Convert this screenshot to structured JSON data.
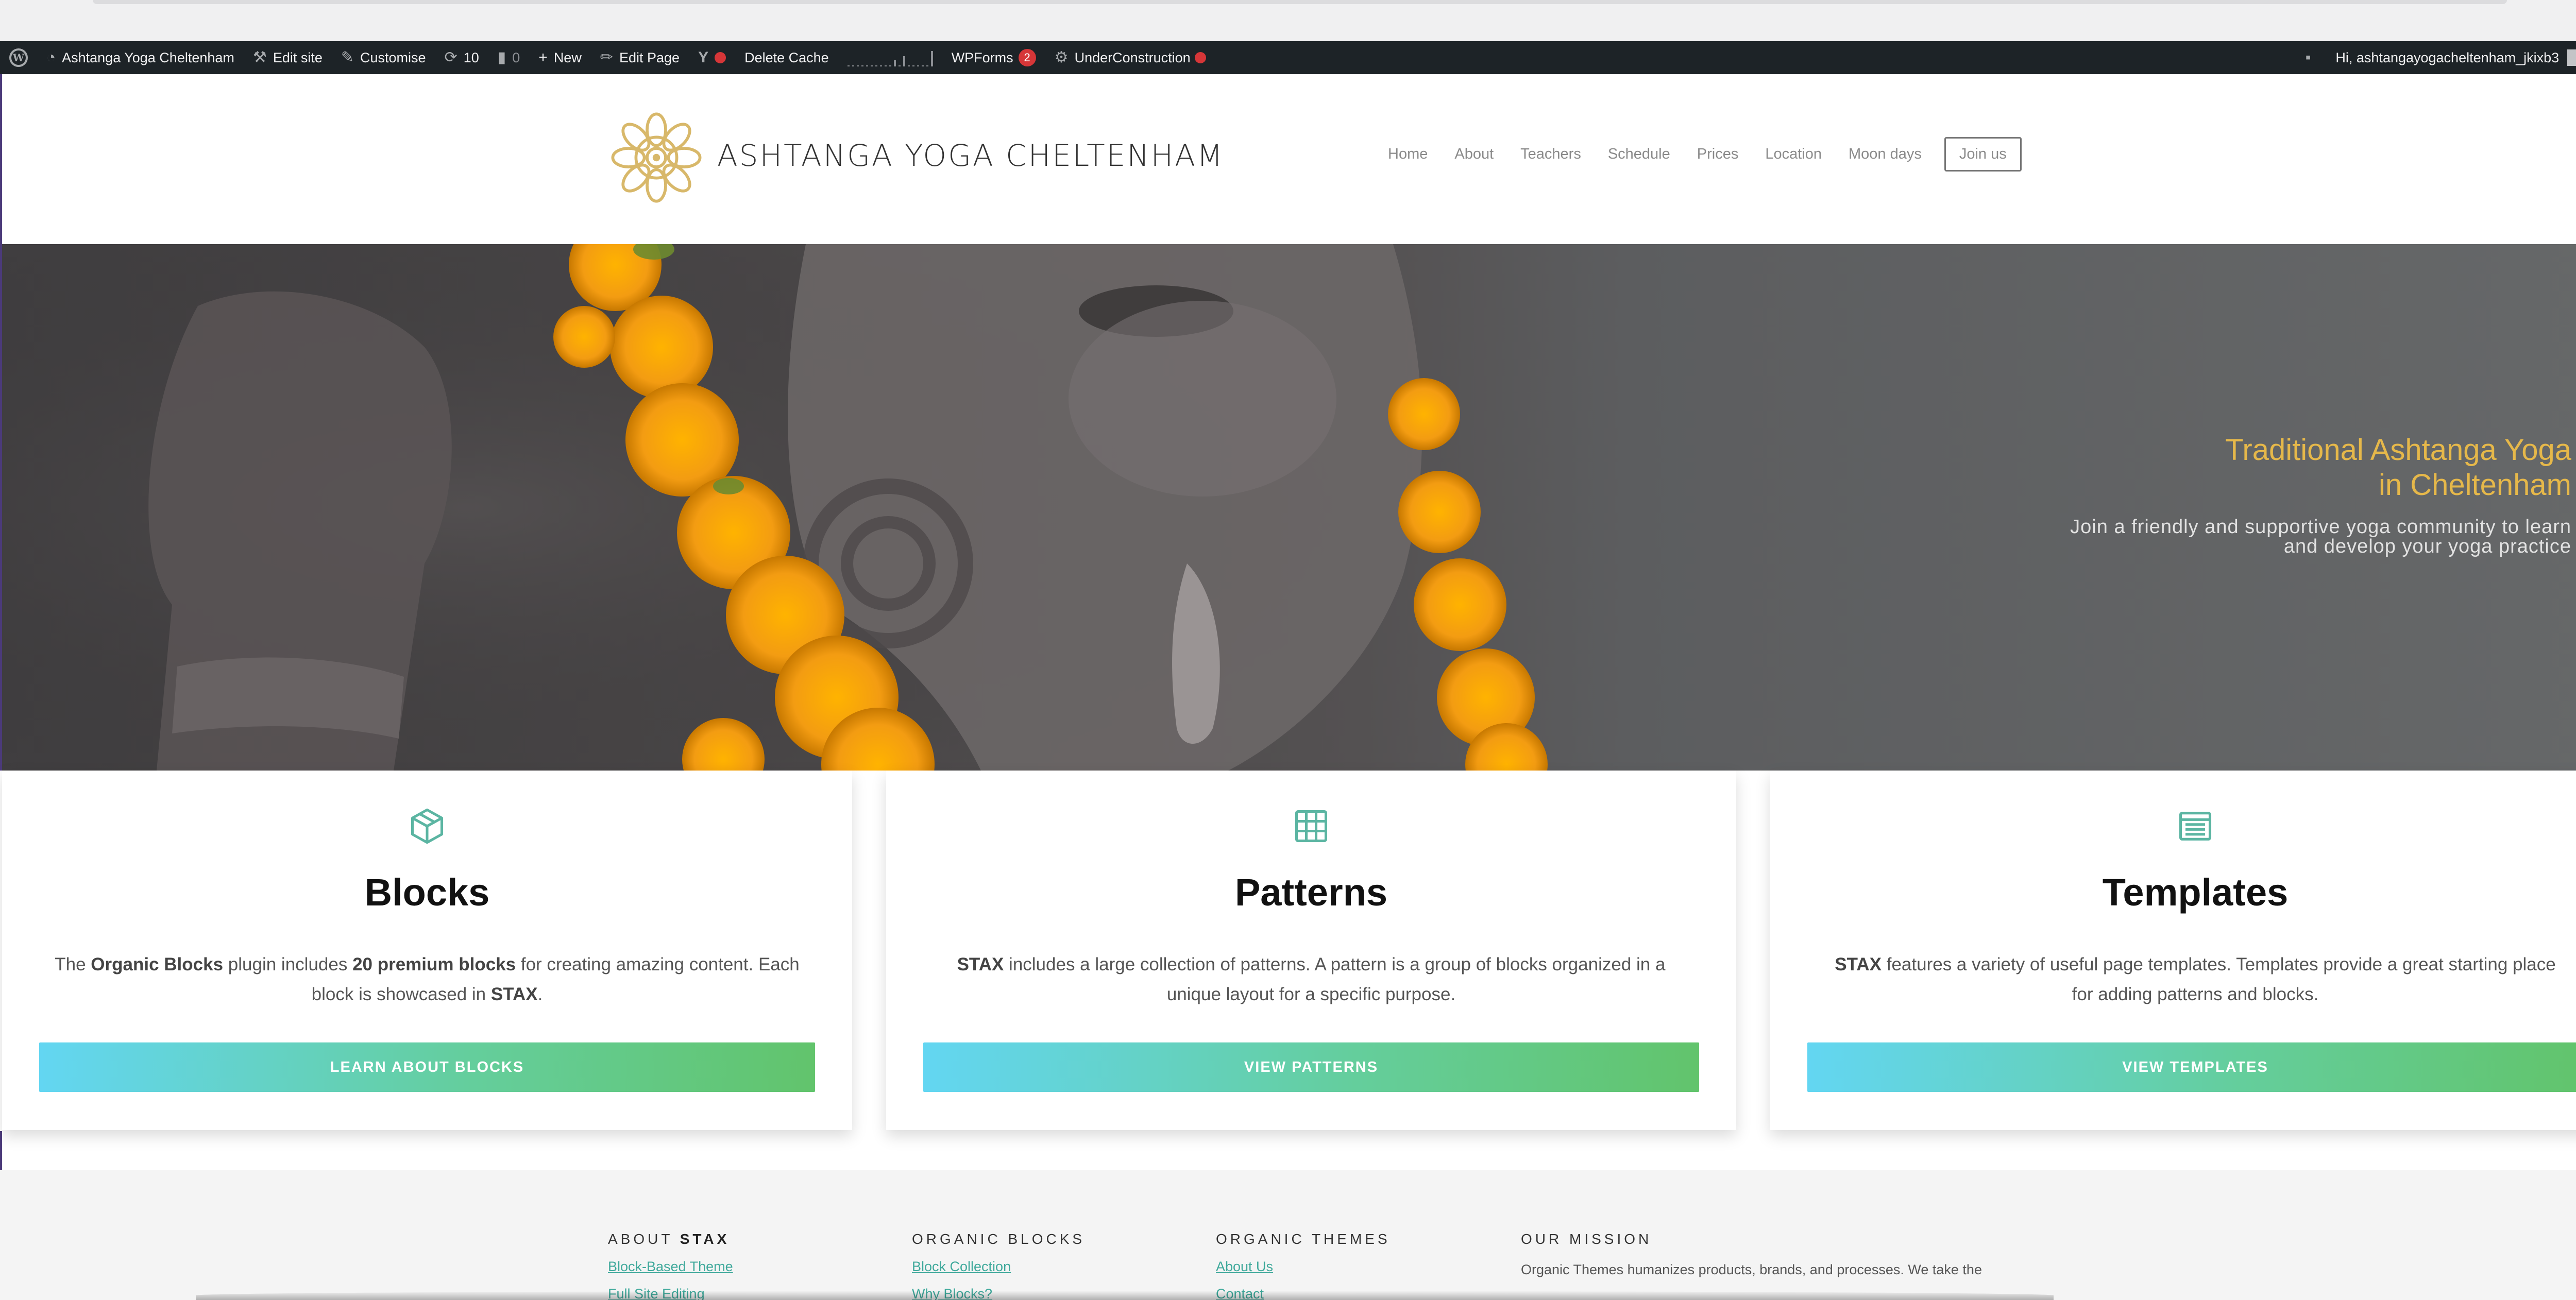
{
  "admin_bar": {
    "site_name": "Ashtanga Yoga Cheltenham",
    "edit_site": "Edit site",
    "customise": "Customise",
    "updates_count": "10",
    "comments_count": "0",
    "new": "New",
    "edit_page": "Edit Page",
    "delete_cache": "Delete Cache",
    "wpforms": "WPForms",
    "wpforms_badge": "2",
    "under_construction": "UnderConstruction",
    "greeting": "Hi, ashtangayogacheltenham_jkixb3"
  },
  "header": {
    "site_title": "ASHTANGA YOGA CHELTENHAM",
    "nav": [
      "Home",
      "About",
      "Teachers",
      "Schedule",
      "Prices",
      "Location",
      "Moon days"
    ],
    "join_label": "Join us"
  },
  "hero": {
    "heading_line1": "Traditional Ashtanga Yoga",
    "heading_line2": "in Cheltenham",
    "sub_line1": "Join a friendly and supportive yoga community to learn",
    "sub_line2": "and develop your yoga practice"
  },
  "cards": [
    {
      "title": "Blocks",
      "text_parts": [
        "The ",
        "Organic Blocks",
        " plugin includes ",
        "20 premium blocks",
        " for creating amazing content. Each block is showcased in ",
        "STAX",
        "."
      ],
      "button": "LEARN ABOUT BLOCKS",
      "icon": "cube-icon"
    },
    {
      "title": "Patterns",
      "text_parts": [
        "STAX",
        " includes a large collection of patterns. A pattern is a group of blocks organized in a unique layout for a specific purpose."
      ],
      "button": "VIEW PATTERNS",
      "icon": "brick-wall-icon"
    },
    {
      "title": "Templates",
      "text_parts": [
        "STAX",
        " features a variety of useful page templates. Templates provide a great starting place for adding patterns and blocks."
      ],
      "button": "VIEW TEMPLATES",
      "icon": "layout-template-icon"
    }
  ],
  "footer": {
    "col1_heading_prefix": "ABOUT ",
    "col1_heading_bold": "STAX",
    "col1_links": [
      "Block-Based Theme",
      "Full Site Editing"
    ],
    "col2_heading": "ORGANIC BLOCKS",
    "col2_links": [
      "Block Collection",
      "Why Blocks?"
    ],
    "col3_heading": "ORGANIC THEMES",
    "col3_links": [
      "About Us",
      "Contact"
    ],
    "col4_heading": "OUR MISSION",
    "col4_text": "Organic Themes humanizes products, brands, and processes. We take the"
  },
  "colors": {
    "admin_bar_bg": "#1d2327",
    "hero_heading": "#e6b84a",
    "accent_teal": "#5bb5a2",
    "button_gradient_start": "#63d6f2",
    "button_gradient_end": "#62c46c",
    "notification_red": "#d63638"
  }
}
